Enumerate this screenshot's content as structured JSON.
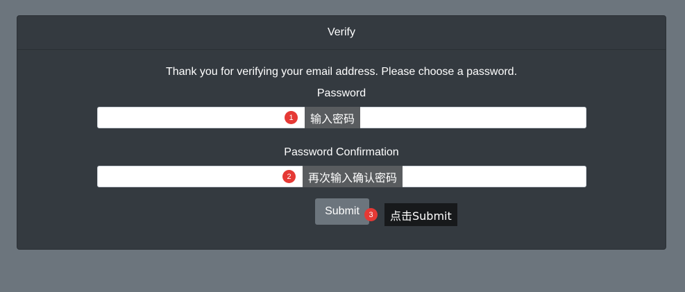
{
  "card": {
    "title": "Verify",
    "intro": "Thank you for verifying your email address. Please choose a password."
  },
  "form": {
    "password_label": "Password",
    "password_value": "",
    "confirm_label": "Password Confirmation",
    "confirm_value": "",
    "submit_label": "Submit"
  },
  "annotations": [
    {
      "number": "1",
      "text": "输入密码"
    },
    {
      "number": "2",
      "text": "再次输入确认密码"
    },
    {
      "number": "3",
      "text": "点击Submit"
    }
  ],
  "colors": {
    "page_background": "#6c757d",
    "card_background": "#343a40",
    "badge": "#e53935",
    "button": "#6c757d"
  }
}
